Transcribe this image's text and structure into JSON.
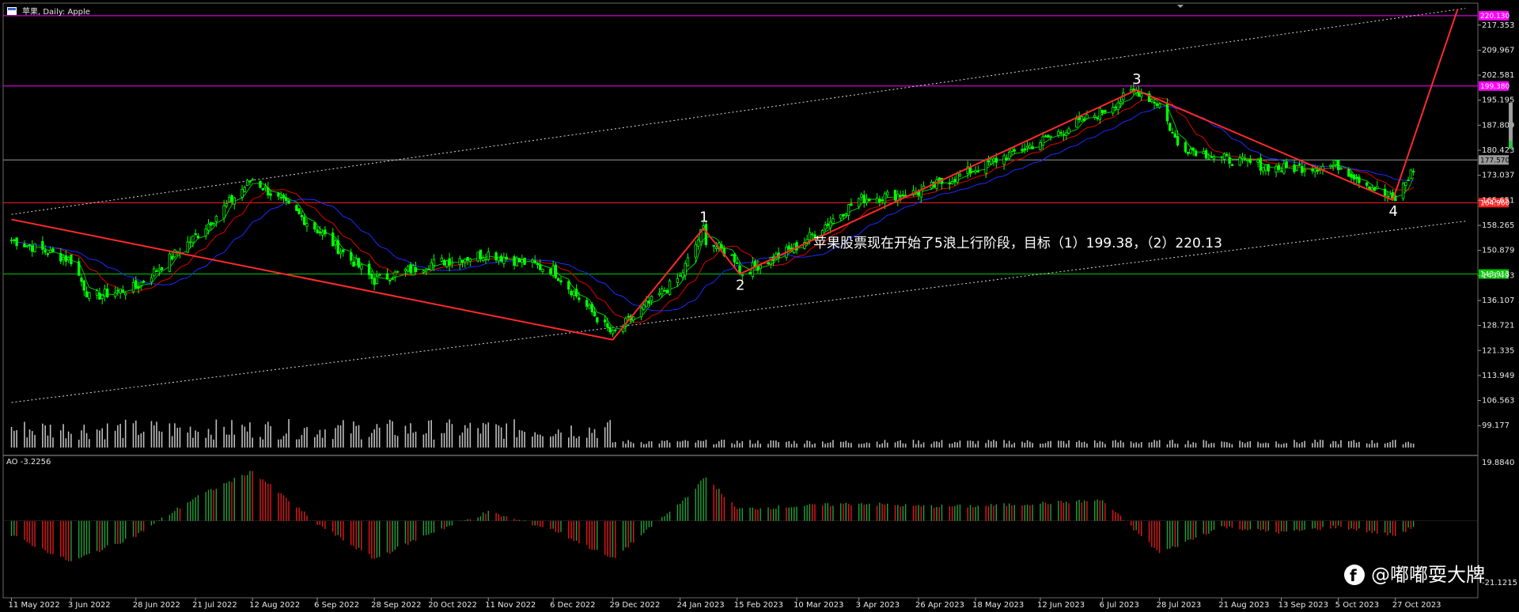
{
  "window": {
    "symbol_label": "苹果, Daily: Apple",
    "indicator_label": "AO -3.2256",
    "watermark": "@嘟嘟耍大牌"
  },
  "annotation": "苹果股票现在开始了5浪上行阶段，目标（1）199.38，（2）220.13",
  "colors": {
    "background": "#000000",
    "bull": "#00ff00",
    "bear": "#ff2020",
    "wave_line": "#ff2a2a",
    "magenta": "#ff00ff",
    "red_level": "#ff2020",
    "green_level": "#00c800",
    "gray_level": "#9a9a9a",
    "sma_fast": "#00c800",
    "sma_mid": "#e00000",
    "sma_slow": "#1d2bff",
    "ao_up": "#22a038",
    "ao_down": "#e01818"
  },
  "chart_data": {
    "type": "candlestick",
    "title": "苹果, Daily: Apple",
    "ylim": [
      92.0,
      221.5
    ],
    "price_ticks": [
      "217.353",
      "209.967",
      "202.581",
      "195.195",
      "187.809",
      "180.423",
      "173.037",
      "165.651",
      "158.265",
      "150.879",
      "143.493",
      "136.107",
      "128.721",
      "121.335",
      "113.949",
      "106.563",
      "99.177"
    ],
    "x_labels": [
      "11 May 2022",
      "3 Jun 2022",
      "28 Jun 2022",
      "21 Jul 2022",
      "12 Aug 2022",
      "6 Sep 2022",
      "28 Sep 2022",
      "20 Oct 2022",
      "11 Nov 2022",
      "6 Dec 2022",
      "29 Dec 2022",
      "24 Jan 2023",
      "15 Feb 2023",
      "10 Mar 2023",
      "3 Apr 2023",
      "26 Apr 2023",
      "18 May 2023",
      "12 Jun 2023",
      "6 Jul 2023",
      "28 Jul 2023",
      "21 Aug 2023",
      "13 Sep 2023",
      "5 Oct 2023",
      "27 Oct 2023"
    ],
    "price_anchors": [
      {
        "date": "11 May 2022",
        "price": 154
      },
      {
        "date": "3 Jun 2022",
        "price": 148
      },
      {
        "date": "10 Jun 2022",
        "price": 137
      },
      {
        "date": "28 Jun 2022",
        "price": 140
      },
      {
        "date": "21 Jul 2022",
        "price": 155
      },
      {
        "date": "12 Aug 2022",
        "price": 172
      },
      {
        "date": "6 Sep 2022",
        "price": 157
      },
      {
        "date": "28 Sep 2022",
        "price": 142
      },
      {
        "date": "20 Oct 2022",
        "price": 147
      },
      {
        "date": "11 Nov 2022",
        "price": 150
      },
      {
        "date": "6 Dec 2022",
        "price": 145
      },
      {
        "date": "29 Dec 2022",
        "price": 126
      },
      {
        "date": "24 Jan 2023",
        "price": 143
      },
      {
        "date": "3 Feb 2023",
        "price": 154
      },
      {
        "date": "15 Feb 2023",
        "price": 148
      },
      {
        "date": "10 Mar 2023",
        "price": 152
      },
      {
        "date": "3 Apr 2023",
        "price": 166
      },
      {
        "date": "26 Apr 2023",
        "price": 168
      },
      {
        "date": "18 May 2023",
        "price": 175
      },
      {
        "date": "12 Jun 2023",
        "price": 183
      },
      {
        "date": "6 Jul 2023",
        "price": 192
      },
      {
        "date": "28 Jul 2023",
        "price": 194
      },
      {
        "date": "4 Aug 2023",
        "price": 182
      },
      {
        "date": "21 Aug 2023",
        "price": 178
      },
      {
        "date": "13 Sep 2023",
        "price": 175
      },
      {
        "date": "5 Oct 2023",
        "price": 176
      },
      {
        "date": "27 Oct 2023",
        "price": 166
      },
      {
        "date": "3 Nov 2023",
        "price": 175
      }
    ],
    "levels": [
      {
        "name": "magenta-top",
        "value": 220.13,
        "label": "220.130",
        "color": "#ff00ff"
      },
      {
        "name": "magenta-target",
        "value": 199.38,
        "label": "199.380",
        "color": "#ff00ff"
      },
      {
        "name": "current",
        "value": 177.57,
        "label": "177.570",
        "color": "#9a9a9a"
      },
      {
        "name": "red-support",
        "value": 164.96,
        "label": "164.960",
        "color": "#ff2020"
      },
      {
        "name": "green-support",
        "value": 143.91,
        "label": "143.913",
        "color": "#00c800"
      }
    ],
    "elliott_waves": [
      {
        "label": "1",
        "date": "2 Feb 2023",
        "price": 157.4
      },
      {
        "label": "2",
        "date": "16 Feb 2023",
        "price": 143.9
      },
      {
        "label": "3",
        "date": "19 Jul 2023",
        "price": 198.2
      },
      {
        "label": "4",
        "date": "26 Oct 2023",
        "price": 165.7
      }
    ],
    "ao_ticks": [
      "19.8840",
      "-21.1215"
    ],
    "ao_ylim": [
      -23.0,
      21.5
    ],
    "ao_anchors": [
      {
        "date": "11 May 2022",
        "value": -5
      },
      {
        "date": "3 Jun 2022",
        "value": -14
      },
      {
        "date": "28 Jun 2022",
        "value": -5
      },
      {
        "date": "21 Jul 2022",
        "value": 8
      },
      {
        "date": "12 Aug 2022",
        "value": 17
      },
      {
        "date": "6 Sep 2022",
        "value": -1
      },
      {
        "date": "28 Sep 2022",
        "value": -13
      },
      {
        "date": "20 Oct 2022",
        "value": -4
      },
      {
        "date": "11 Nov 2022",
        "value": 3
      },
      {
        "date": "6 Dec 2022",
        "value": -3
      },
      {
        "date": "29 Dec 2022",
        "value": -13
      },
      {
        "date": "24 Jan 2023",
        "value": 6
      },
      {
        "date": "3 Feb 2023",
        "value": 15
      },
      {
        "date": "15 Feb 2023",
        "value": 4
      },
      {
        "date": "10 Mar 2023",
        "value": 5
      },
      {
        "date": "3 Apr 2023",
        "value": 6
      },
      {
        "date": "26 Apr 2023",
        "value": 5
      },
      {
        "date": "18 May 2023",
        "value": 5
      },
      {
        "date": "12 Jun 2023",
        "value": 6
      },
      {
        "date": "6 Jul 2023",
        "value": 7
      },
      {
        "date": "28 Jul 2023",
        "value": -11
      },
      {
        "date": "21 Aug 2023",
        "value": -2
      },
      {
        "date": "13 Sep 2023",
        "value": -4
      },
      {
        "date": "5 Oct 2023",
        "value": -2
      },
      {
        "date": "27 Oct 2023",
        "value": -5
      },
      {
        "date": "3 Nov 2023",
        "value": -2
      }
    ]
  }
}
